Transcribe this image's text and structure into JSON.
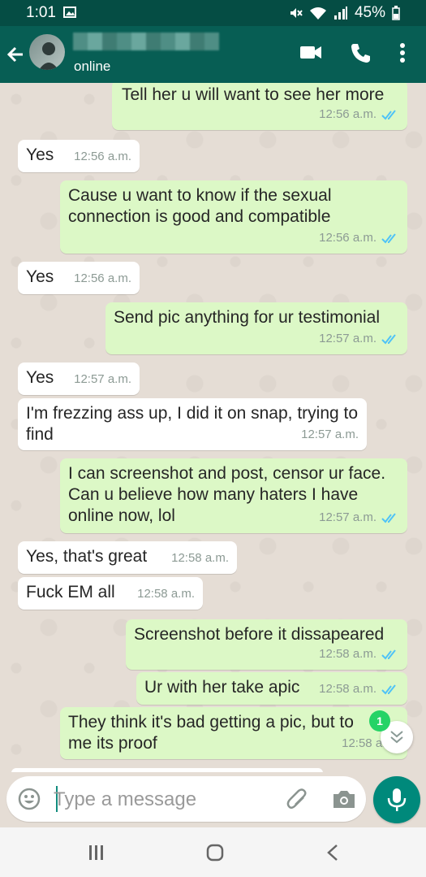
{
  "status_bar": {
    "time": "1:01",
    "battery": "45%"
  },
  "header": {
    "presence": "online"
  },
  "messages": [
    {
      "dir": "out",
      "text": "Tell her u will want to see her more",
      "time": "12:56 a.m."
    },
    {
      "dir": "in",
      "text": "Yes",
      "time": "12:56 a.m."
    },
    {
      "dir": "out",
      "text": "Cause u want to know if the sexual connection is good and compatible",
      "time": "12:56 a.m."
    },
    {
      "dir": "in",
      "text": "Yes",
      "time": "12:56 a.m."
    },
    {
      "dir": "out",
      "text": "Send pic anything for ur testimonial",
      "time": "12:57 a.m."
    },
    {
      "dir": "in",
      "text": "Yes",
      "time": "12:57 a.m."
    },
    {
      "dir": "in",
      "text": "I'm frezzing ass up, I did it on snap, trying to find",
      "time": "12:57 a.m."
    },
    {
      "dir": "out",
      "text": "I can screenshot and post, censor ur face. Can u believe how many haters I have online now, lol",
      "time": "12:57 a.m."
    },
    {
      "dir": "in",
      "text": "Yes, that's great",
      "time": "12:58 a.m."
    },
    {
      "dir": "in",
      "text": "Fuck EM all",
      "time": "12:58 a.m."
    },
    {
      "dir": "out",
      "text": "Screenshot before it dissapeared",
      "time": "12:58 a.m."
    },
    {
      "dir": "out",
      "text": "Ur with her take apic",
      "time": "12:58 a.m."
    },
    {
      "dir": "out",
      "text": "They think it's bad getting a pic, but to me its proof",
      "time": "12:58 a.m."
    }
  ],
  "unread_badge": "1",
  "composer": {
    "placeholder": "Type a message"
  },
  "colors": {
    "header": "#075e54",
    "outgoing": "#dcf8c6",
    "incoming": "#ffffff",
    "read_ticks": "#4fc3f7",
    "accent": "#00897b"
  },
  "icons": [
    "back-arrow-icon",
    "video-call-icon",
    "phone-icon",
    "more-options-icon",
    "emoji-icon",
    "attach-icon",
    "camera-icon",
    "mic-icon",
    "scroll-down-icon",
    "recent-apps-icon",
    "home-icon",
    "nav-back-icon"
  ]
}
